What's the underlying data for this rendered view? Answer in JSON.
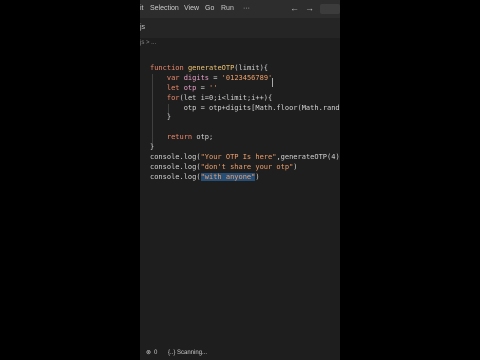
{
  "menu": {
    "partial_left": "it",
    "items": [
      "Selection",
      "View",
      "Go",
      "Run",
      "···"
    ]
  },
  "tab": {
    "label": "js"
  },
  "breadcrumb": "js > ...",
  "code_lines": [
    {
      "tokens": [
        {
          "t": "function ",
          "c": "kw"
        },
        {
          "t": "generateOTP",
          "c": "fn"
        },
        {
          "t": "(limit){",
          "c": ""
        }
      ]
    },
    {
      "tokens": [
        {
          "t": "    var ",
          "c": "kw"
        },
        {
          "t": "digits",
          "c": "var"
        },
        {
          "t": " = ",
          "c": ""
        },
        {
          "t": "'0123456789'",
          "c": "str"
        }
      ]
    },
    {
      "tokens": [
        {
          "t": "    let ",
          "c": "kw"
        },
        {
          "t": "otp",
          "c": "var"
        },
        {
          "t": " = ",
          "c": ""
        },
        {
          "t": "''",
          "c": "str"
        }
      ]
    },
    {
      "tokens": [
        {
          "t": "    for",
          "c": "kw"
        },
        {
          "t": "(let i=0;i<limit;i++){",
          "c": ""
        }
      ]
    },
    {
      "tokens": [
        {
          "t": "        otp = otp+digits[Math.floor(Math.random()*",
          "c": ""
        }
      ]
    },
    {
      "tokens": [
        {
          "t": "    }",
          "c": ""
        }
      ]
    },
    {
      "tokens": [
        {
          "t": "",
          "c": ""
        }
      ]
    },
    {
      "tokens": [
        {
          "t": "    return ",
          "c": "kw"
        },
        {
          "t": "otp;",
          "c": ""
        }
      ]
    },
    {
      "tokens": [
        {
          "t": "}",
          "c": ""
        }
      ]
    },
    {
      "tokens": [
        {
          "t": "console.log(",
          "c": ""
        },
        {
          "t": "\"Your OTP Is here\"",
          "c": "str"
        },
        {
          "t": ",generateOTP(4))",
          "c": ""
        }
      ]
    },
    {
      "tokens": [
        {
          "t": "console.log(",
          "c": ""
        },
        {
          "t": "\"don't share your otp\"",
          "c": "str"
        },
        {
          "t": ")",
          "c": ""
        }
      ]
    },
    {
      "tokens": [
        {
          "t": "console.log(",
          "c": ""
        },
        {
          "t": "\"with anyone\"",
          "c": "str sel"
        },
        {
          "t": ")",
          "c": ""
        }
      ]
    }
  ],
  "status": {
    "errors": "0",
    "scanning": "{..} Scanning..."
  }
}
